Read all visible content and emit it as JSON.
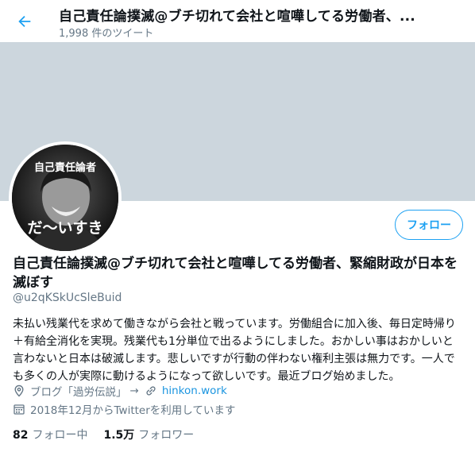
{
  "header": {
    "title": "自己責任論撲滅@ブチ切れて会社と喧嘩してる労働者、...",
    "tweet_count": "1,998 件のツイート"
  },
  "avatar": {
    "caption_top": "自己責任論者",
    "caption_bottom": "だ～いすき"
  },
  "follow_button": {
    "label": "フォロー"
  },
  "profile": {
    "name": "自己責任論撲滅@ブチ切れて会社と喧嘩してる労働者、緊縮財政が日本を滅ぼす",
    "handle": "@u2qKSkUcSleBuid",
    "bio": "未払い残業代を求めて働きながら会社と戦っています。労働組合に加入後、毎日定時帰り＋有給全消化を実現。残業代も1分単位で出るようにしました。おかしい事はおかしいと言わないと日本は破滅します。悲しいですが行動の伴わない権利主張は無力です。一人でも多くの人が実際に動けるようになって欲しいです。最近ブログ始めました。",
    "location": "ブログ「過労伝説」",
    "location_arrow": "→",
    "website": "hinkon.work",
    "joined": "2018年12月からTwitterを利用しています"
  },
  "stats": {
    "following_count": "82",
    "following_label": "フォロー中",
    "followers_count": "1.5万",
    "followers_label": "フォロワー"
  },
  "colors": {
    "accent": "#1da1f2",
    "link": "#1b95e0",
    "banner": "#ccd6dd",
    "secondary_text": "#657786"
  }
}
